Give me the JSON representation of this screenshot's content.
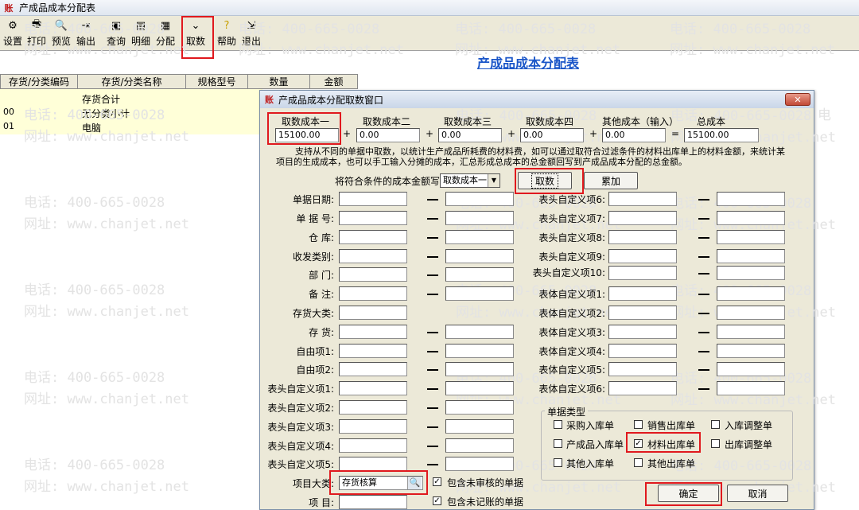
{
  "window": {
    "title": "产成品成本分配表"
  },
  "toolbar": [
    {
      "label": "设置",
      "icon": "settings-icon"
    },
    {
      "label": "打印",
      "icon": "print-icon"
    },
    {
      "label": "预览",
      "icon": "preview-icon"
    },
    {
      "label": "输出",
      "icon": "export-icon"
    },
    {
      "label": "查询",
      "icon": "query-icon"
    },
    {
      "label": "明细",
      "icon": "detail-icon"
    },
    {
      "label": "分配",
      "icon": "allocate-icon"
    },
    {
      "label": "取数",
      "icon": "chevron-down-icon"
    },
    {
      "label": "帮助",
      "icon": "help-icon"
    },
    {
      "label": "退出",
      "icon": "exit-icon"
    }
  ],
  "report": {
    "title": "产成品成本分配表",
    "columns": [
      "存货/分类编码",
      "存货/分类名称",
      "规格型号",
      "数量",
      "金额"
    ],
    "rows": [
      {
        "code": "",
        "name": "存货合计"
      },
      {
        "code": "00",
        "name": "无分类小计"
      },
      {
        "code": "01",
        "name": "电脑"
      }
    ]
  },
  "watermark": {
    "phone": "电话: 400-665-0028",
    "url": "网址: www.chanjet.net"
  },
  "dialog": {
    "title": "产成品成本分配取数窗口",
    "close": "✕",
    "cost_headers": [
      "取数成本一",
      "取数成本二",
      "取数成本三",
      "取数成本四",
      "其他成本（输入）",
      "总成本"
    ],
    "cost_values": [
      "15100.00",
      "0.00",
      "0.00",
      "0.00",
      "0.00",
      "15100.00"
    ],
    "ops": [
      "+",
      "+",
      "+",
      "+",
      "="
    ],
    "description": "支持从不同的单据中取数，以统计生产成品所耗费的材料费，如可以通过取符合过滤条件的材料出库单上的材料金额，来统计某项目的生成成本，也可以手工输入分摊的成本，汇总形成总成本的总金额回写到产成品成本分配的总金额。",
    "write_to_label": "将符合条件的成本金额写到:",
    "write_to_value": "取数成本一",
    "fetch_button": "取数",
    "accumulate_button": "累加",
    "left_fields": [
      "单据日期:",
      "单 据 号:",
      "仓    库:",
      "收发类别:",
      "部    门:",
      "备    注:",
      "存货大类:",
      "存    货:",
      "自由项1:",
      "自由项2:",
      "表头自定义项1:",
      "表头自定义项2:",
      "表头自定义项3:",
      "表头自定义项4:",
      "表头自定义项5:",
      "项目大类:",
      "项    目:"
    ],
    "right_fields": [
      "表头自定义项6:",
      "表头自定义项7:",
      "表头自定义项8:",
      "表头自定义项9:",
      "表头自定义项10:",
      "表体自定义项1:",
      "表体自定义项2:",
      "表体自定义项3:",
      "表体自定义项4:",
      "表体自定义项5:",
      "表体自定义项6:"
    ],
    "project_category_value": "存货核算",
    "include_unaudited": "包含未审核的单据",
    "include_unposted": "包含未记账的单据",
    "doc_type_title": "单据类型",
    "doc_types": [
      {
        "label": "采购入库单",
        "checked": false
      },
      {
        "label": "销售出库单",
        "checked": false
      },
      {
        "label": "入库调整单",
        "checked": false
      },
      {
        "label": "产成品入库单",
        "checked": false
      },
      {
        "label": "材料出库单",
        "checked": true
      },
      {
        "label": "出库调整单",
        "checked": false
      },
      {
        "label": "其他入库单",
        "checked": false
      },
      {
        "label": "其他出库单",
        "checked": false
      }
    ],
    "ok_button": "确定",
    "cancel_button": "取消"
  }
}
